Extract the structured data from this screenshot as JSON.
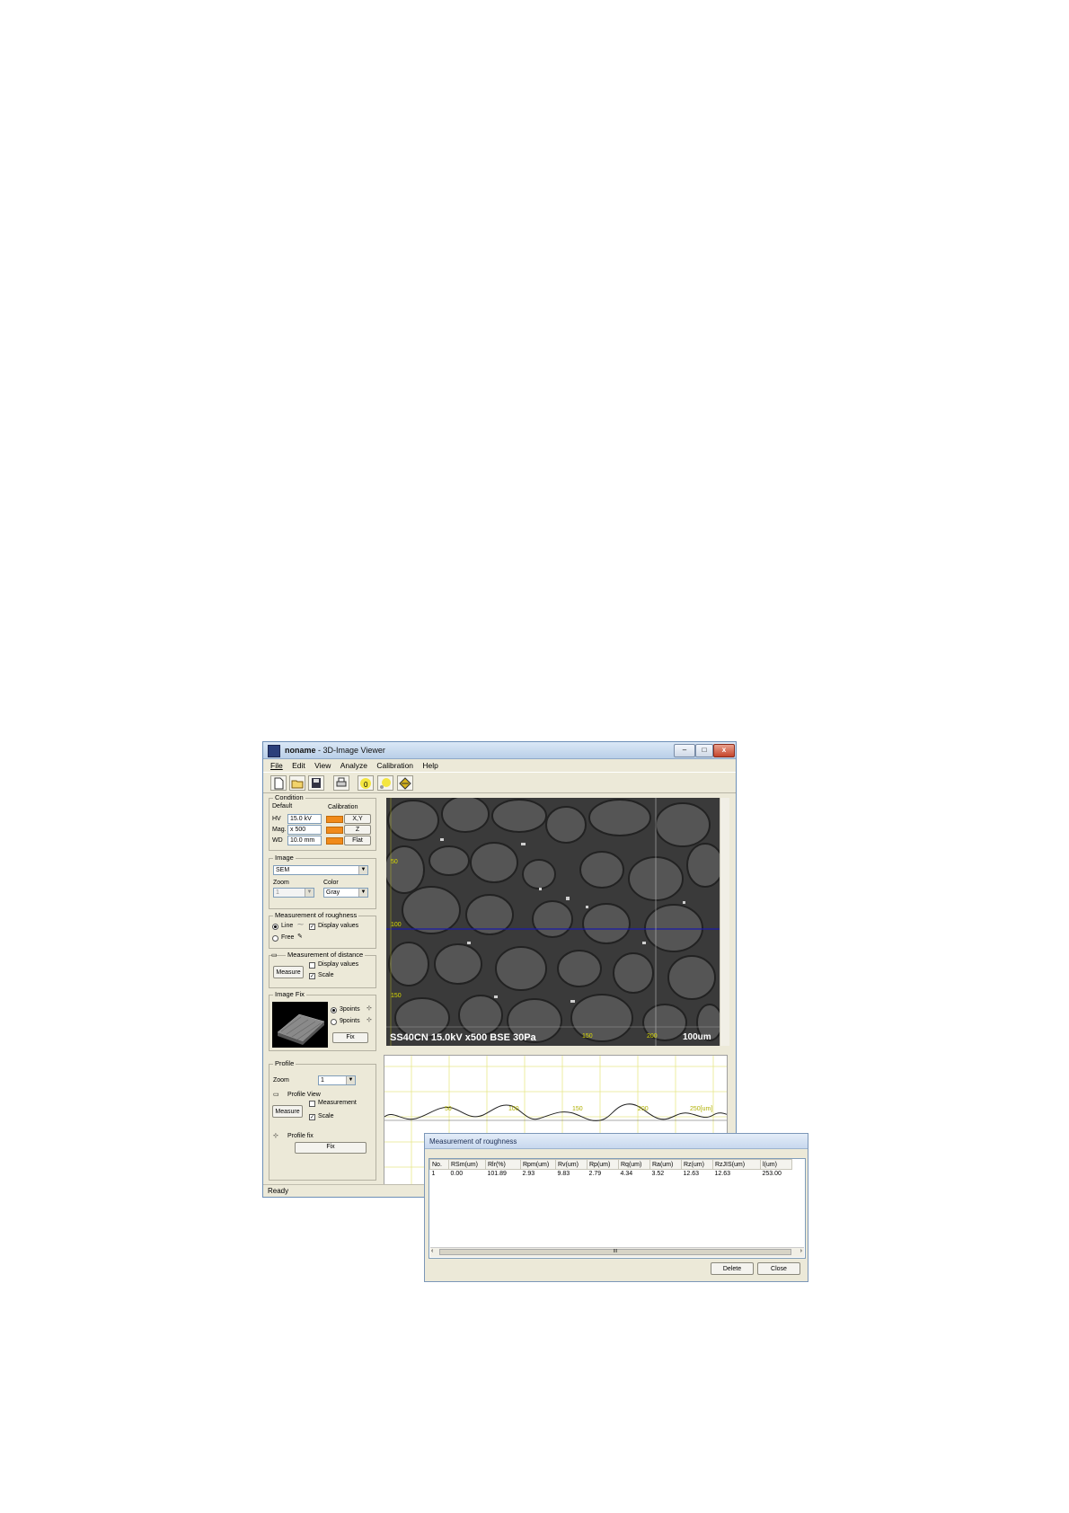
{
  "window": {
    "title_doc": "noname",
    "title_app": " - 3D-Image Viewer",
    "controls": {
      "minimize": "–",
      "maximize": "□",
      "close": "x"
    }
  },
  "menu": {
    "items": [
      "File",
      "Edit",
      "View",
      "Analyze",
      "Calibration",
      "Help"
    ]
  },
  "toolbar": {
    "icons": [
      "new-file-icon",
      "open-folder-icon",
      "save-disk-icon",
      "print-icon",
      "calibrate-xy-icon",
      "light-source-icon",
      "3d-view-icon"
    ]
  },
  "condition": {
    "label": "Condition",
    "default_label": "Default",
    "calibration_label": "Calibration",
    "hv_label": "HV",
    "hv_value": "15.0 kV",
    "mag_label": "Mag.",
    "mag_value": "x 500",
    "wd_label": "WD",
    "wd_value": "10.0 mm",
    "xy_button": "X,Y",
    "z_button": "Z",
    "flat_button": "Flat",
    "swatch_color": "#f08a1a"
  },
  "image": {
    "label": "Image",
    "source_value": "SEM",
    "zoom_label": "Zoom",
    "zoom_value": "1",
    "color_label": "Color",
    "color_value": "Gray"
  },
  "roughness": {
    "label": "Measurement of roughness",
    "line_label": "Line",
    "free_label": "Free",
    "display_values_label": "Display values",
    "display_values_checked": true,
    "mode": "Line"
  },
  "distance": {
    "label": "Measurement of distance",
    "measure_button": "Measure",
    "display_values_label": "Display values",
    "display_values_checked": false,
    "scale_label": "Scale",
    "scale_checked": true
  },
  "image_fix": {
    "label": "Image Fix",
    "opt1_label": "3points",
    "opt2_label": "9points",
    "fix_button": "Fix"
  },
  "sem": {
    "caption": "SS40CN 15.0kV x500 BSE 30Pa",
    "scale_label": "100um",
    "y_ticks": [
      "50",
      "100",
      "150"
    ],
    "x_ticks": [
      "150",
      "200"
    ]
  },
  "profile": {
    "label": "Profile",
    "zoom_label": "Zoom",
    "zoom_value": "1",
    "view_label": "Profile View",
    "measure_button": "Measure",
    "measurement_label": "Measurement",
    "measurement_checked": false,
    "scale_label": "Scale",
    "scale_checked": true,
    "fix_label": "Profile fix",
    "fix_button": "Fix",
    "x_ticks": [
      "50",
      "100",
      "150",
      "200",
      "250[um]"
    ]
  },
  "status": {
    "text": "Ready"
  },
  "dialog": {
    "title": "Measurement of roughness",
    "columns": [
      "No.",
      "RSm(um)",
      "Rlr(%)",
      "Rpm(um)",
      "Rv(um)",
      "Rp(um)",
      "Rq(um)",
      "Ra(um)",
      "Rz(um)",
      "RzJIS(um)",
      "l(um)"
    ],
    "rows": [
      [
        "1",
        "0.00",
        "101.89",
        "2.93",
        "9.83",
        "2.79",
        "4.34",
        "3.52",
        "12.63",
        "12.63",
        "253.00"
      ]
    ],
    "delete_button": "Delete",
    "close_button": "Close",
    "scroll_thumb": "III"
  }
}
